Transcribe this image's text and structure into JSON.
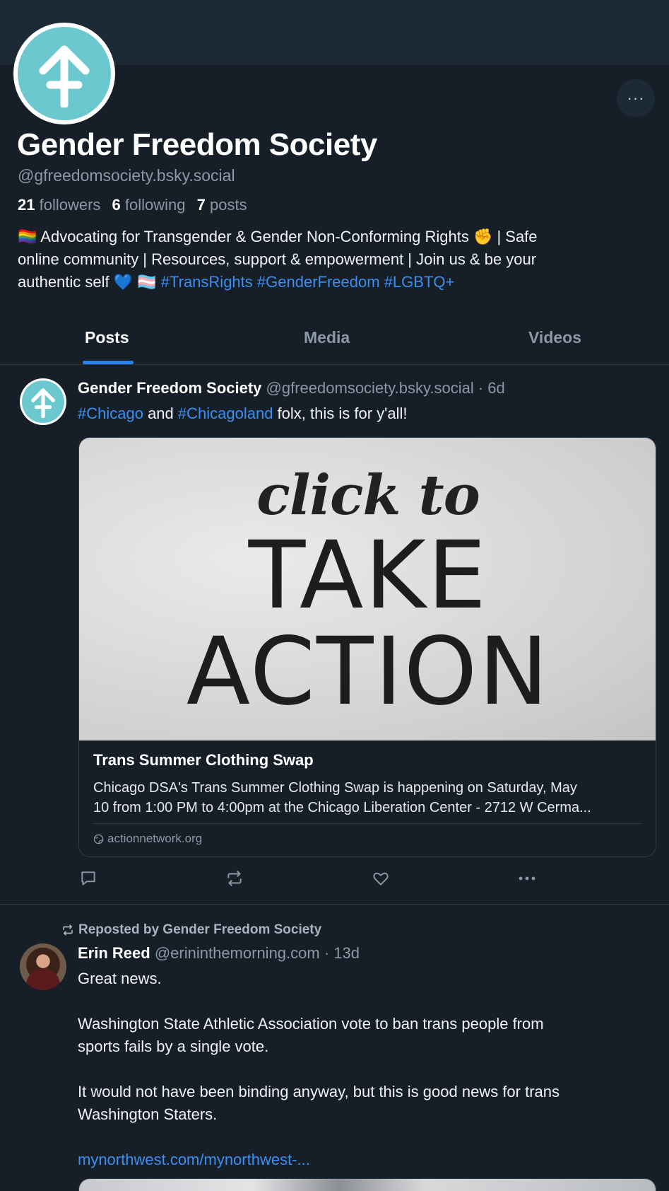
{
  "profile": {
    "display_name": "Gender Freedom Society",
    "handle": "@gfreedomsociety.bsky.social",
    "followers_count": "21",
    "followers_label": "followers",
    "following_count": "6",
    "following_label": "following",
    "posts_count": "7",
    "posts_label": "posts",
    "more_label": "···",
    "bio_line1": "🏳️‍🌈 Advocating for Transgender & Gender Non-Conforming Rights ✊ | Safe",
    "bio_line2": "online community | Resources, support & empowerment | Join us & be your",
    "bio_line3_text": "authentic self 💙 🏳️‍⚧️ ",
    "bio_tags": [
      "#TransRights",
      "#GenderFreedom",
      "#LGBTQ+"
    ]
  },
  "tabs": [
    {
      "label": "Posts",
      "active": true
    },
    {
      "label": "Media",
      "active": false
    },
    {
      "label": "Videos",
      "active": false
    }
  ],
  "posts": [
    {
      "author_name": "Gender Freedom Society",
      "author_handle": "@gfreedomsociety.bsky.social",
      "time": "· 6d",
      "text_tag1": "#Chicago",
      "text_mid": " and ",
      "text_tag2": "#Chicagoland",
      "text_end": " folx, this is for y'all!",
      "card": {
        "image_line1": "click to",
        "image_line2": "TAKE",
        "image_line3": "ACTION",
        "title": "Trans Summer Clothing Swap",
        "desc_line1": "Chicago DSA's Trans Summer Clothing Swap is happening on Saturday, May",
        "desc_line2": "10 from 1:00 PM to 4:00pm at the Chicago Liberation Center - 2712 W Cerma...",
        "domain": "actionnetwork.org"
      }
    },
    {
      "repost_label": "Reposted by Gender Freedom Society",
      "author_name": "Erin Reed",
      "author_handle": "@erininthemorning.com",
      "time": "· 13d",
      "para1": "Great news.",
      "para2_line1": "Washington State Athletic Association vote to ban trans people from",
      "para2_line2": "sports fails by a single vote.",
      "para3_line1": "It would not have been binding anyway, but this is good news for trans",
      "para3_line2": "Washington Staters.",
      "link": "mynorthwest.com/mynorthwest-..."
    }
  ],
  "colors": {
    "background": "#161e27",
    "accent": "#2b80f2",
    "avatar_teal": "#6cc8cf"
  }
}
